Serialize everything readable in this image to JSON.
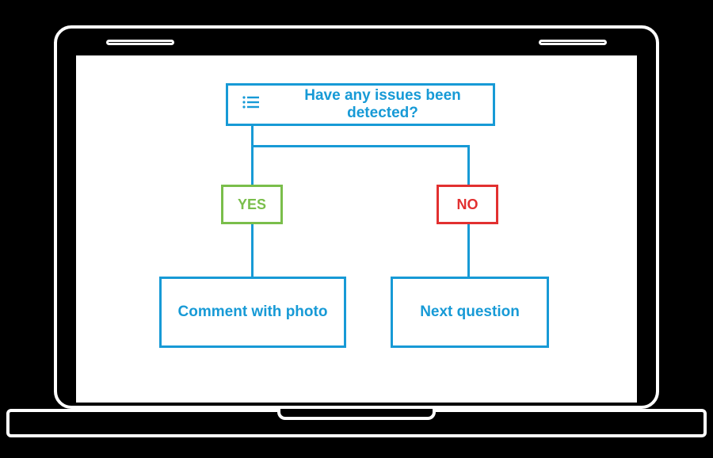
{
  "diagram": {
    "question": "Have any issues been detected?",
    "yes_label": "YES",
    "no_label": "NO",
    "yes_result": "Comment with photo",
    "no_result": "Next question"
  },
  "colors": {
    "primary": "#179ad6",
    "yes": "#7abe4b",
    "no": "#e23030"
  }
}
